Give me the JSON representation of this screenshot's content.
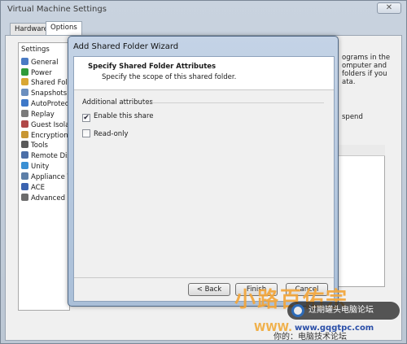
{
  "window": {
    "title": "Virtual Machine Settings",
    "close_label": "✕",
    "tabs": [
      {
        "label": "Hardware"
      },
      {
        "label": "Options"
      }
    ]
  },
  "settings": {
    "header": "Settings",
    "items": [
      {
        "label": "General",
        "icon": "general-icon",
        "color": "#4a7bc4"
      },
      {
        "label": "Power",
        "icon": "power-icon",
        "color": "#2f9b3a"
      },
      {
        "label": "Shared Folders",
        "icon": "shared-folders-icon",
        "color": "#d9a734"
      },
      {
        "label": "Snapshots",
        "icon": "snapshots-icon",
        "color": "#6b8fbf"
      },
      {
        "label": "AutoProtect",
        "icon": "autoprotect-icon",
        "color": "#3d78c8"
      },
      {
        "label": "Replay",
        "icon": "replay-icon",
        "color": "#7b7b7b"
      },
      {
        "label": "Guest Isolation",
        "icon": "guest-isolation-icon",
        "color": "#b04848"
      },
      {
        "label": "Encryption",
        "icon": "encryption-icon",
        "color": "#c89632"
      },
      {
        "label": "Tools",
        "icon": "tools-icon",
        "color": "#5a5a5a"
      },
      {
        "label": "Remote Display",
        "icon": "remote-display-icon",
        "color": "#4a6ea8"
      },
      {
        "label": "Unity",
        "icon": "unity-icon",
        "color": "#3a8fd4"
      },
      {
        "label": "Appliance View",
        "icon": "appliance-view-icon",
        "color": "#5d7fa8"
      },
      {
        "label": "ACE",
        "icon": "ace-icon",
        "color": "#3b63b0"
      },
      {
        "label": "Advanced",
        "icon": "advanced-icon",
        "color": "#6c6c6c"
      }
    ]
  },
  "background_text": {
    "lines": [
      "ograms in the",
      "omputer and",
      "folders if you",
      "ata."
    ],
    "spend": "spend"
  },
  "dialog": {
    "title": "Add Shared Folder Wizard",
    "heading": "Specify Shared Folder Attributes",
    "subheading": "Specify the scope of this shared folder.",
    "group_label": "Additional attributes",
    "options": [
      {
        "label": "Enable this share",
        "checked": true
      },
      {
        "label": "Read-only",
        "checked": false
      }
    ],
    "buttons": {
      "back": "< Back",
      "finish": "Finish",
      "cancel": "Cancel"
    }
  },
  "watermark": {
    "brand": "小路百佑宗",
    "badge": "过期罐头电脑论坛",
    "url": "www.gqgtpc.com",
    "www": "WWW.",
    "you": "你的：电脑技术论坛"
  }
}
